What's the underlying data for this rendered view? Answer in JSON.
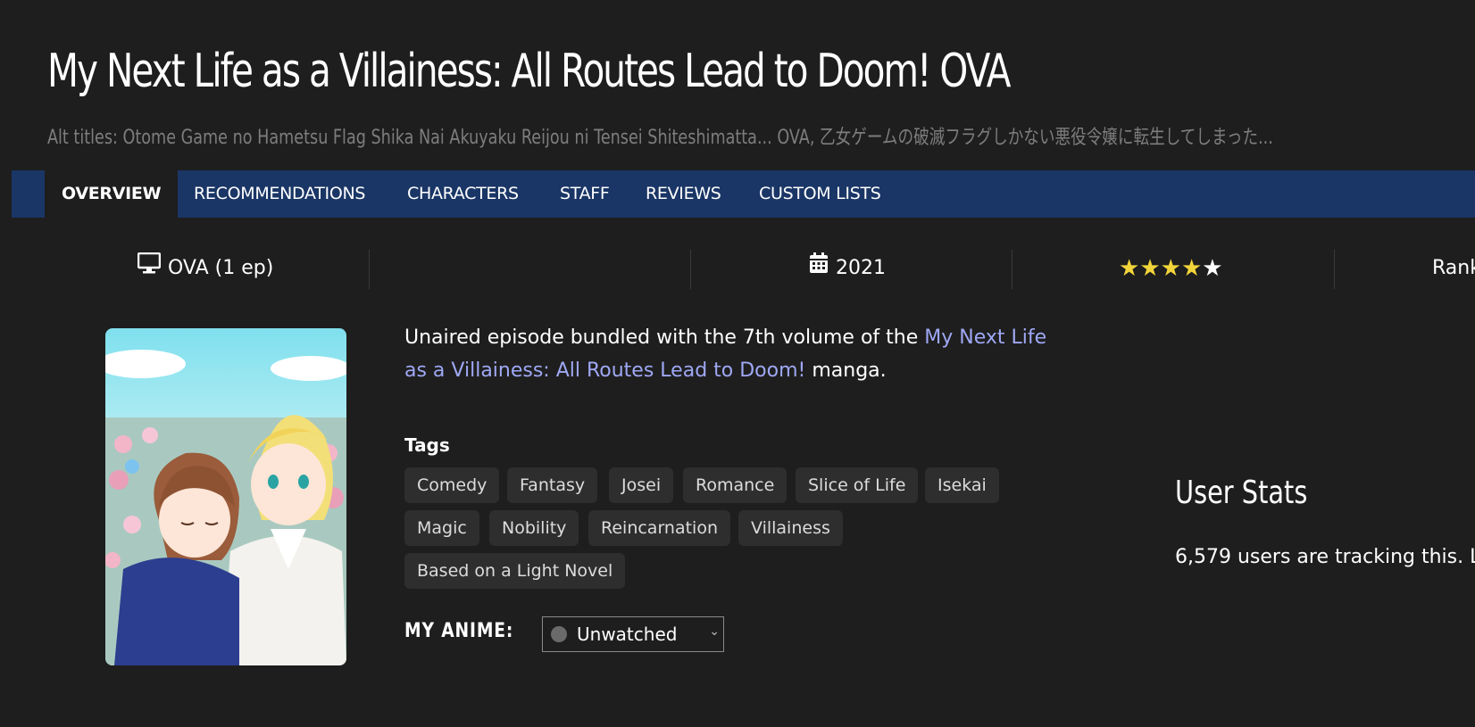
{
  "title": "My Next Life as a Villainess: All Routes Lead to Doom! OVA",
  "alt_titles": "Alt titles: Otome Game no Hametsu Flag Shika Nai Akuyaku Reijou ni Tensei Shiteshimatta... OVA, 乙女ゲームの破滅フラグしかない悪役令嬢に転生してしまった...",
  "nav": {
    "tabs": [
      {
        "label": "OVERVIEW",
        "active": true
      },
      {
        "label": "RECOMMENDATIONS"
      },
      {
        "label": "CHARACTERS"
      },
      {
        "label": "STAFF"
      },
      {
        "label": "REVIEWS"
      },
      {
        "label": "CUSTOM LISTS"
      }
    ]
  },
  "info": {
    "type_icon": "monitor-icon",
    "type": "OVA (1 ep)",
    "year_icon": "calendar-icon",
    "year": "2021",
    "rating_stars_filled": 4,
    "rating_stars_total": 5,
    "rank_label": "Rank"
  },
  "cover": {
    "alt": "cover image",
    "icon": "anime-cover-art"
  },
  "description": {
    "before": "Unaired episode bundled with the 7th volume of the ",
    "link": "My Next Life as a Villainess: All Routes Lead to Doom!",
    "after": " manga."
  },
  "tags": {
    "heading": "Tags",
    "items": [
      "Comedy",
      "Fantasy",
      "Josei",
      "Romance",
      "Slice of Life",
      "Isekai",
      "Magic",
      "Nobility",
      "Reincarnation",
      "Villainess",
      "Based on a Light Novel"
    ]
  },
  "my_anime": {
    "label": "MY ANIME:",
    "status": "Unwatched"
  },
  "user_stats": {
    "heading": "User Stats",
    "text": "6,579 users are tracking this. L"
  },
  "colors": {
    "background": "#1e1e1e",
    "nav": "#1a3666",
    "link": "#9fa8f5",
    "star": "#f2d53a",
    "tag_bg": "#2e2e2e"
  }
}
